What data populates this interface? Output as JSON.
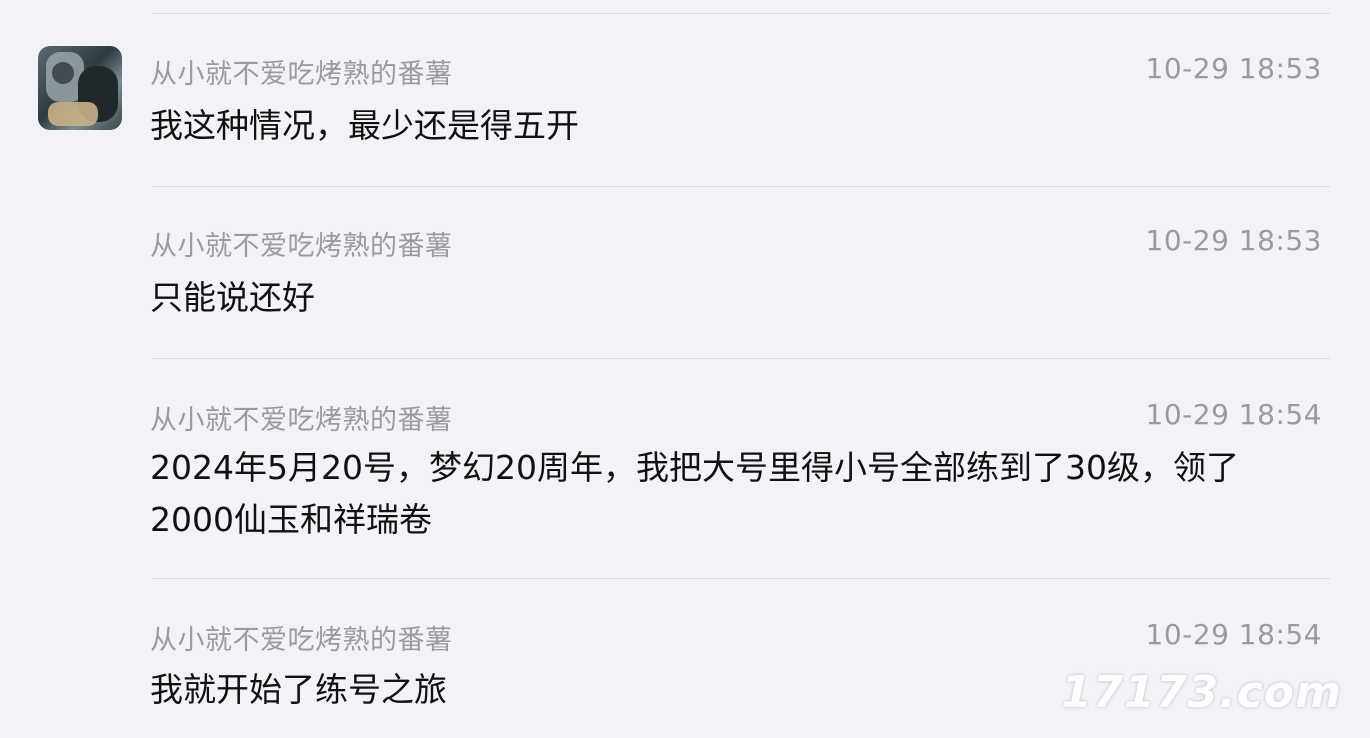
{
  "messages": [
    {
      "username": "从小就不爱吃烤熟的番薯",
      "time": "10-29 18:53",
      "text": "我这种情况，最少还是得五开",
      "has_avatar": true
    },
    {
      "username": "从小就不爱吃烤熟的番薯",
      "time": "10-29 18:53",
      "text": "只能说还好",
      "has_avatar": false
    },
    {
      "username": "从小就不爱吃烤熟的番薯",
      "time": "10-29 18:54",
      "text": "2024年5月20号，梦幻20周年，我把大号里得小号全部练到了30级，领了2000仙玉和祥瑞卷",
      "has_avatar": false
    },
    {
      "username": "从小就不爱吃烤熟的番薯",
      "time": "10-29 18:54",
      "text": "我就开始了练号之旅",
      "has_avatar": false
    }
  ],
  "watermark": "17173.com"
}
